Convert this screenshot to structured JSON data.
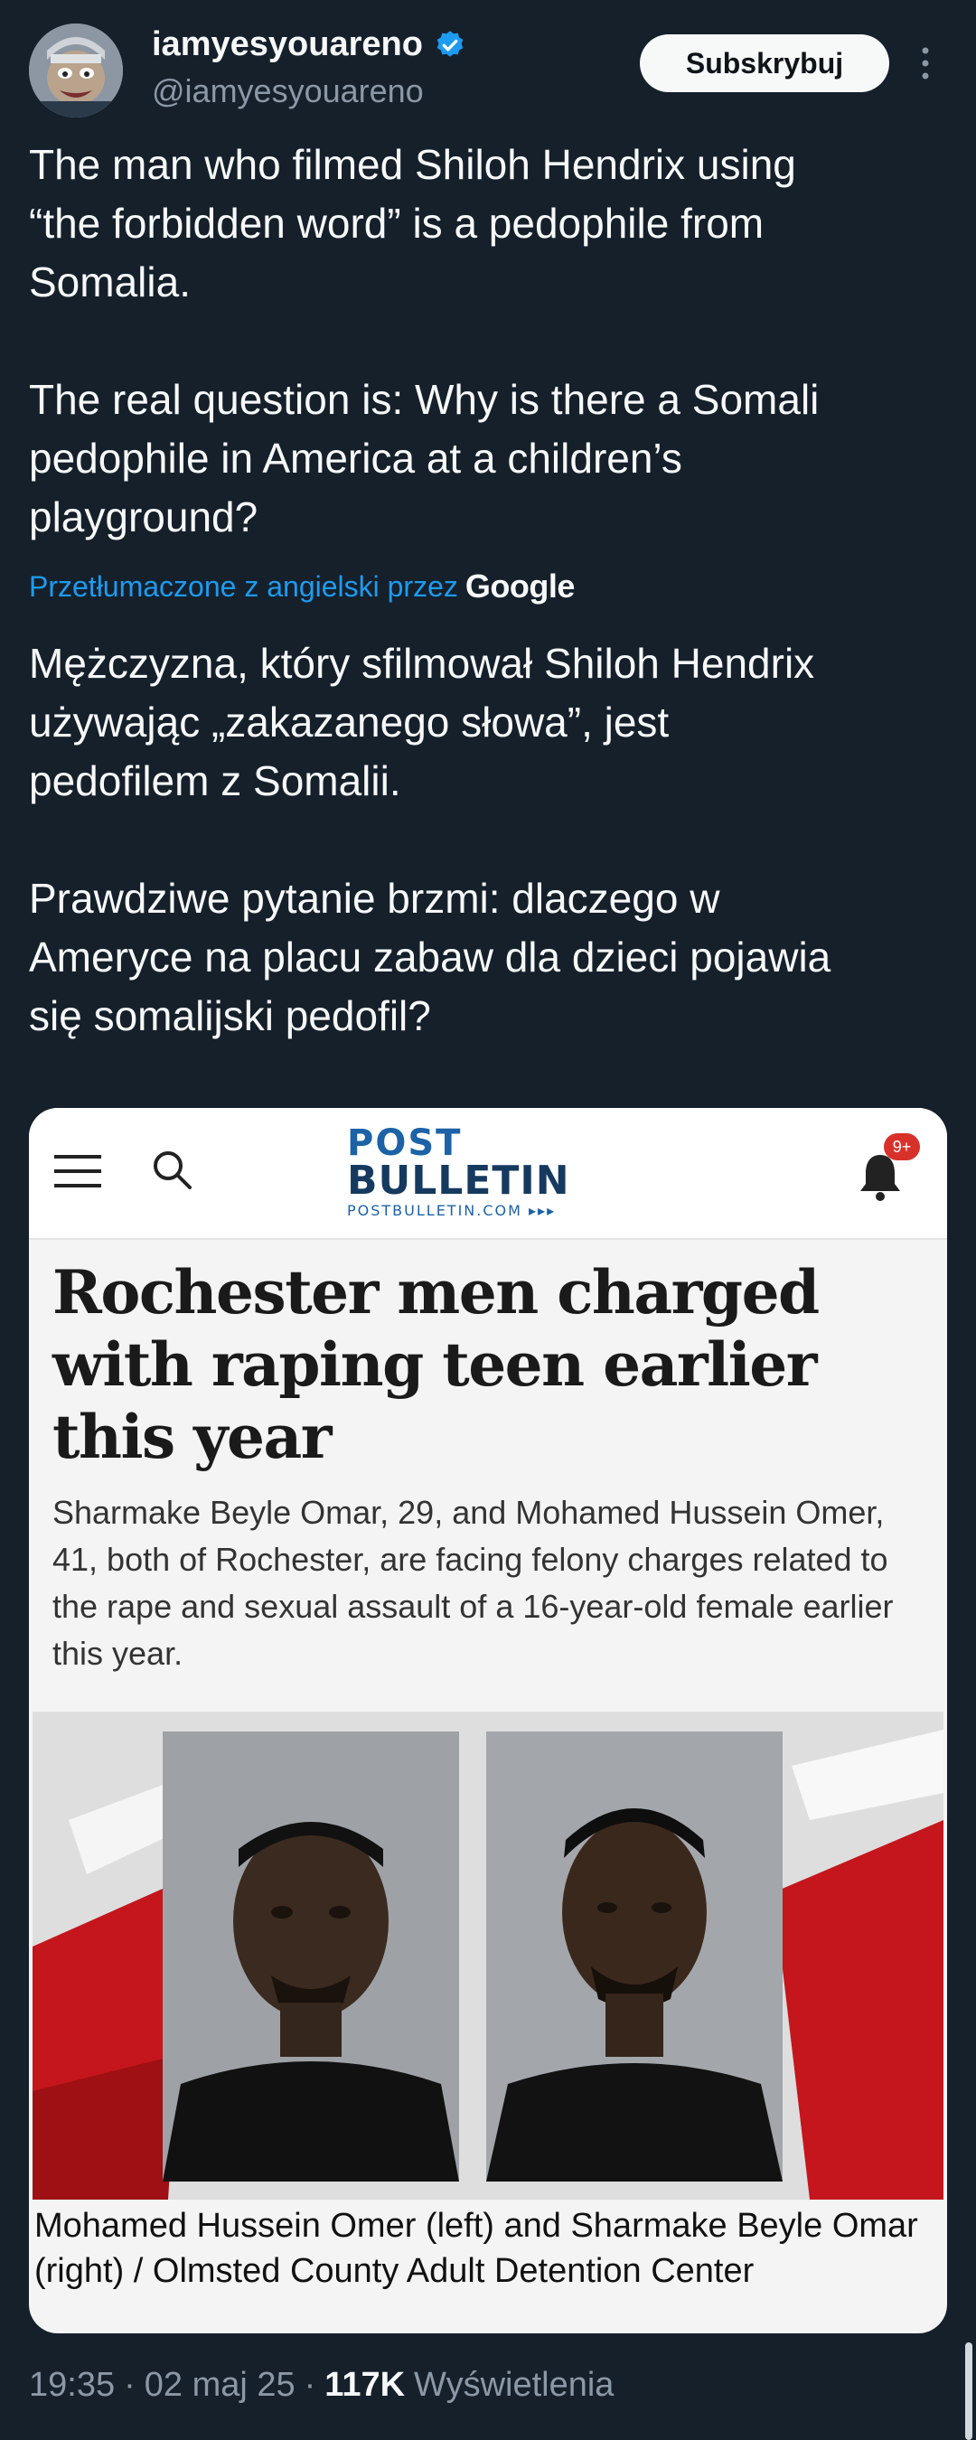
{
  "author": {
    "display_name": "iamyesyouareno",
    "handle": "@iamyesyouareno",
    "verified": true
  },
  "actions": {
    "subscribe_label": "Subskrybuj"
  },
  "tweet": {
    "text": "The man who filmed Shiloh Hendrix using\n“the forbidden word” is a pedophile from\nSomalia.\n\nThe real question is: Why is there a Somali\npedophile in America at a children’s\nplayground?",
    "translated_label": "Przetłumaczone z angielski przez",
    "translator_brand": "Google",
    "translated_text": "Mężczyzna, który sfilmował Shiloh Hendrix\nużywając „zakazanego słowa”, jest\npedofilem z Somalii.\n\nPrawdziwe pytanie brzmi: dlaczego w\nAmeryce na placu zabaw dla dzieci pojawia\nsię somalijski pedofil?"
  },
  "media": {
    "site_name_top": "POST",
    "site_name_bottom": "BULLETIN",
    "site_domain": "POSTBULLETIN.COM ▸▸▸",
    "notification_badge": "9+",
    "headline": "Rochester men charged with raping teen earlier this year",
    "dek": "Sharmake Beyle Omar, 29, and Mohamed Hussein Omer, 41, both of Rochester, are facing felony charges related to the rape and sexual assault of a 16-year-old female earlier this year.",
    "caption": "Mohamed Hussein Omer (left) and Sharmake Beyle Omar (right) / Olmsted County Adult Detention Center"
  },
  "meta": {
    "time": "19:35",
    "date": "02 maj 25",
    "views_count": "117K",
    "views_label": "Wyświetlenia",
    "separator": "·"
  },
  "colors": {
    "background": "#15202b",
    "text": "#f7f9f9",
    "secondary": "#8b98a5",
    "link": "#1d9bf0",
    "verified": "#1d9bf0"
  }
}
